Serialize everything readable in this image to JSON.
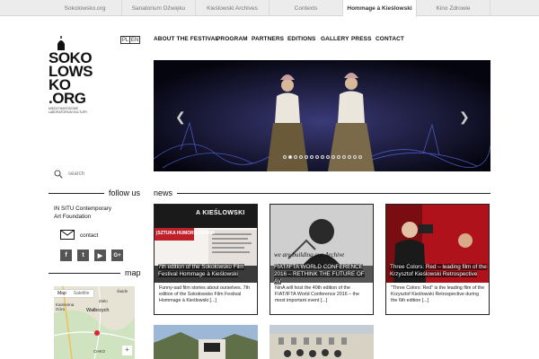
{
  "topbar": {
    "tabs": [
      {
        "label": "Sokolowsko.org"
      },
      {
        "label": "Sanatorium Dźwięku"
      },
      {
        "label": "Kieślowski Archives"
      },
      {
        "label": "Contexts"
      },
      {
        "label": "Hommage à Kieślowski"
      },
      {
        "label": "Kino Zdrowie"
      }
    ]
  },
  "logo": {
    "line1": "SOKO",
    "line2": "LOWS",
    "line3": "KO",
    "line4": ".ORG",
    "sub1": "MIĘDZYNARODOWE",
    "sub2": "LABORATORIUM KULTURY"
  },
  "lang": {
    "pl": "PL",
    "en": "EN"
  },
  "nav": {
    "items": [
      {
        "label": "ABOUT THE FESTIVAL"
      },
      {
        "label": "PROGRAM"
      },
      {
        "label": "PARTNERS"
      },
      {
        "label": "EDITIONS"
      },
      {
        "label": "GALLERY"
      },
      {
        "label": "PRESS"
      },
      {
        "label": "CONTACT"
      }
    ]
  },
  "search": {
    "placeholder": "search"
  },
  "sidebar": {
    "follow_title": "follow us",
    "org_line1": "IN SITU Contemporary",
    "org_line2": "Art Foundation",
    "contact_label": "contact",
    "socials": [
      "f",
      "t",
      "▶",
      "G+"
    ],
    "map_title": "map",
    "map_tabs": [
      "Map",
      "Satellite"
    ],
    "map_places": [
      "Kamienna Góra",
      "Wałbrzych",
      "Świdn",
      "CHKO",
      "Zielo"
    ]
  },
  "news": {
    "title": "news",
    "cards": [
      {
        "caption": "7th edition of the Sokołowsko Film Festival Hommage à Kieślowski",
        "text": "Funny-sad film stories about ourselves. 7th edition of the Sokołowsko Film Festival Hommage à Kieślowski [...]",
        "poster_title": "A KIEŚLOWSKI",
        "poster_sub": "|SZTUKA HUMORU I IRONII"
      },
      {
        "caption": "FIAT/IFTA WORLD CONFERENCE 2016 – RETHINK THE FUTURE OF AV",
        "text": "NinA will host the 40th edition of the FIAT/IFTA World Conference 2016 – the most important event [...]",
        "poster_title": "we are building our Archive"
      },
      {
        "caption": "Three Colors: Red – leading film of the Krzysztof Kieślowski Retrospective",
        "text": "\"Three Colors: Red\" is the leading film of the Krzysztof Kieślowski Retrospective during the 6th edition [...]"
      }
    ]
  },
  "slider": {
    "dot_count": 15,
    "active_dot": 1
  },
  "colors": {
    "topbar_bg": "#ececec",
    "red_accent": "#c0202a",
    "hero_bg": "#0a0a18"
  }
}
